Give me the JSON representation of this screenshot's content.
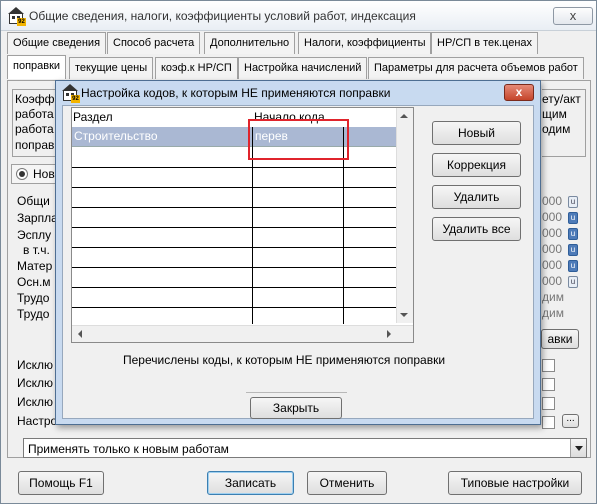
{
  "window": {
    "title": "Общие сведения, налоги, коэффициенты условий работ, индексация",
    "close": "x"
  },
  "tabs_row1": [
    "Общие сведения",
    "Способ расчета",
    "Дополнительно",
    "Налоги, коэффициенты",
    "НР/СП в тек.ценах"
  ],
  "tabs_row2": [
    "поправки",
    "текущие цены",
    "коэф.к НР/СП",
    "Настройка начислений",
    "Параметры для расчета объемов работ"
  ],
  "background": {
    "text_left": [
      "Коэфф",
      "работа",
      "работа",
      "поправ"
    ],
    "text_right": [
      "ету/акт",
      "щим",
      "одим"
    ],
    "radio_label": "Нов",
    "labels": [
      "Общи",
      "Зарпла",
      "Эсплу",
      "в т.ч.",
      "Матер",
      "Осн.м",
      "Трудо",
      "Трудо"
    ],
    "values": [
      "000",
      "000",
      "000",
      "000",
      "000",
      "000",
      "дим",
      "дим"
    ],
    "button_partial": "авки",
    "checks": [
      "Исклю",
      "Исклю",
      "Исклю",
      "Настро"
    ],
    "ellipsis": "..."
  },
  "combo": {
    "value": "Применять только к новым работам"
  },
  "footer": {
    "help": "Помощь F1",
    "save": "Записать",
    "cancel": "Отменить",
    "defaults": "Типовые настройки"
  },
  "dialog": {
    "title": "Настройка кодов, к которым НЕ применяются поправки",
    "close": "x",
    "columns": [
      "Раздел",
      "Начало кода",
      ""
    ],
    "rows": [
      [
        "Строительство",
        "перев",
        ""
      ]
    ],
    "empty_rows": 9,
    "buttons": {
      "new": "Новый",
      "edit": "Коррекция",
      "delete": "Удалить",
      "delete_all": "Удалить все"
    },
    "note": "Перечислены коды, к которым НЕ применяются поправки",
    "close_button": "Закрыть"
  }
}
